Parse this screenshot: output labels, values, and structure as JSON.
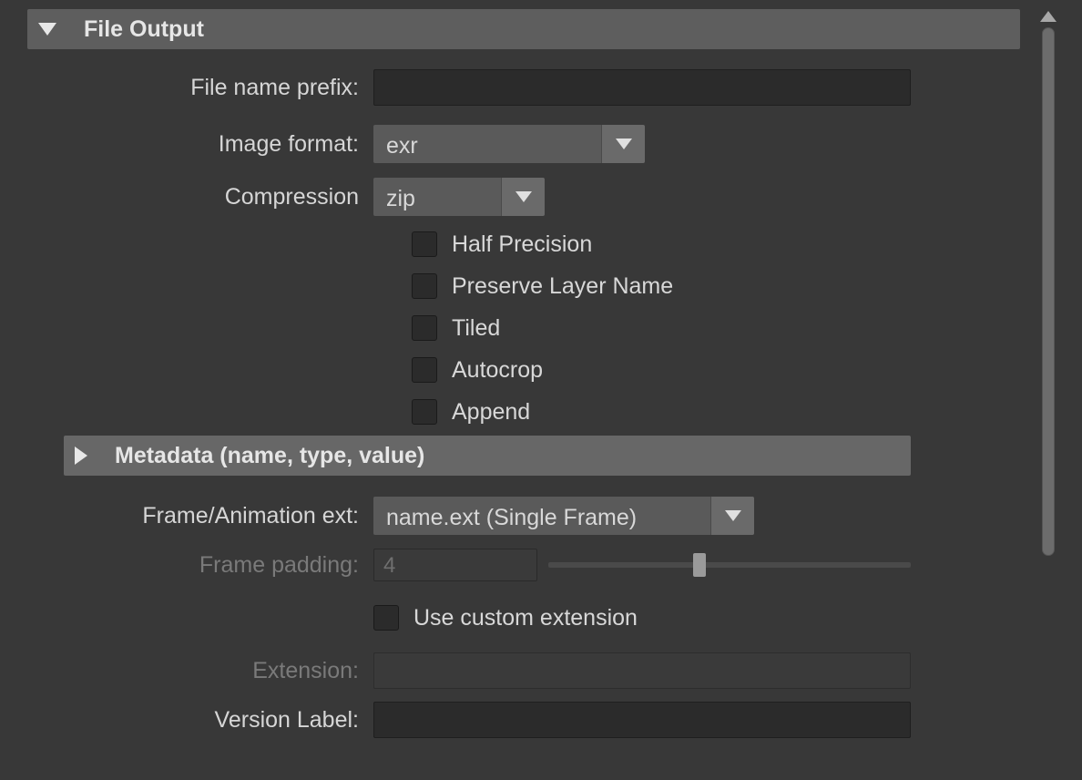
{
  "sections": {
    "file_output": {
      "title": "File Output",
      "expanded": true
    },
    "metadata": {
      "title": "Metadata (name, type, value)",
      "expanded": false
    }
  },
  "labels": {
    "file_name_prefix": "File name prefix:",
    "image_format": "Image format:",
    "compression": "Compression",
    "frame_ext": "Frame/Animation ext:",
    "frame_padding": "Frame padding:",
    "extension": "Extension:",
    "version_label": "Version Label:"
  },
  "values": {
    "file_name_prefix": "",
    "image_format": "exr",
    "compression": "zip",
    "frame_ext": "name.ext (Single Frame)",
    "frame_padding": "4",
    "extension": "",
    "version_label": ""
  },
  "checkboxes": {
    "half_precision": {
      "label": "Half Precision",
      "checked": false
    },
    "preserve_layer": {
      "label": "Preserve Layer Name",
      "checked": false
    },
    "tiled": {
      "label": "Tiled",
      "checked": false
    },
    "autocrop": {
      "label": "Autocrop",
      "checked": false
    },
    "append": {
      "label": "Append",
      "checked": false
    },
    "use_custom_ext": {
      "label": "Use custom extension",
      "checked": false
    }
  },
  "slider": {
    "frame_padding_pos_pct": 40
  }
}
